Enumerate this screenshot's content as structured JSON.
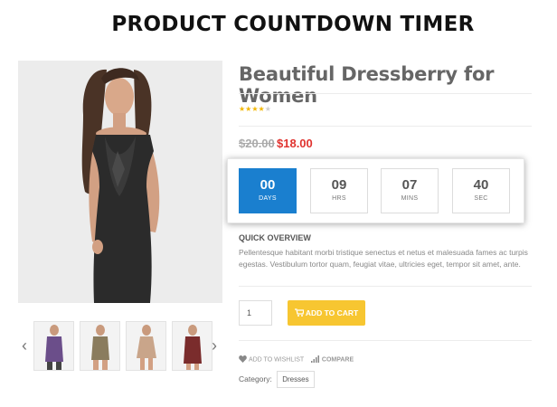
{
  "banner": {
    "title": "PRODUCT COUNTDOWN TIMER"
  },
  "product": {
    "title": "Beautiful Dressberry for Women",
    "rating": 4,
    "rating_max": 5,
    "price_old": "$20.00",
    "price_new": "$18.00"
  },
  "countdown": [
    {
      "value": "00",
      "label": "DAYS",
      "active": true
    },
    {
      "value": "09",
      "label": "HRS",
      "active": false
    },
    {
      "value": "07",
      "label": "MINS",
      "active": false
    },
    {
      "value": "40",
      "label": "SEC",
      "active": false
    }
  ],
  "overview": {
    "heading": "QUICK OVERVIEW",
    "text": "Pellentesque habitant morbi tristique senectus et netus et malesuada fames ac turpis egestas. Vestibulum tortor quam, feugiat vitae, ultricies eget, tempor sit amet, ante."
  },
  "cart": {
    "quantity": "1",
    "button_label": "ADD TO CART"
  },
  "links": {
    "wishlist": "ADD TO WISHLIST",
    "compare": "COMPARE"
  },
  "category": {
    "label": "Category:",
    "value": "Dresses"
  },
  "colors": {
    "accent_blue": "#1a7fcf",
    "cart_yellow": "#f7c631",
    "sale_red": "#e0332f",
    "star": "#f2b705"
  },
  "icons": [
    "chevron-left-icon",
    "chevron-right-icon",
    "cart-icon",
    "heart-icon",
    "compare-bars-icon",
    "star-icon"
  ]
}
